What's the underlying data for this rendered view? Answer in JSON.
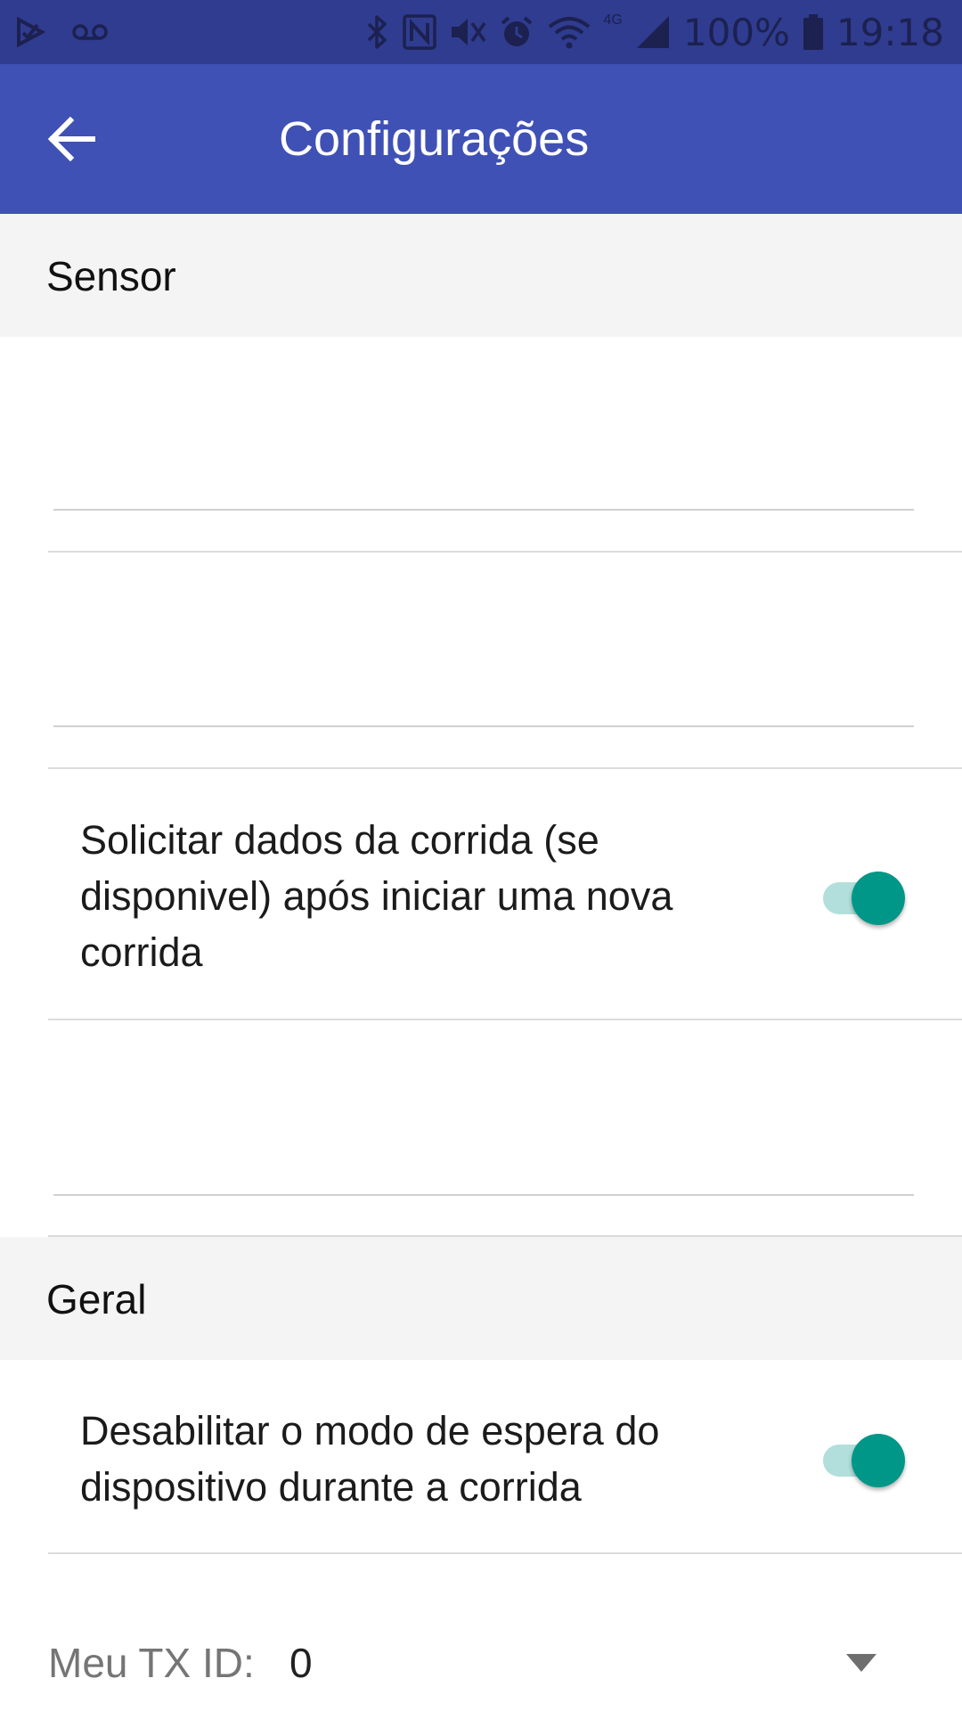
{
  "status_bar": {
    "left_icons": [
      "play-check-icon",
      "voicemail-icon"
    ],
    "right_icons": [
      "bluetooth-icon",
      "nfc-icon",
      "mute-icon",
      "alarm-icon",
      "wifi-icon",
      "signal-icon",
      "battery-icon"
    ],
    "network_label": "4G",
    "battery_text": "100%",
    "time": "19:18"
  },
  "app_bar": {
    "title": "Configurações",
    "back_icon": "arrow-back-icon"
  },
  "sections": {
    "sensor": {
      "header": "Sensor",
      "request_run_data": {
        "label": "Solicitar dados da corrida (se disponivel) após iniciar uma nova corrida",
        "enabled": true
      }
    },
    "general": {
      "header": "Geral",
      "disable_standby": {
        "label": "Desabilitar o modo de espera do dispositivo durante a corrida",
        "enabled": true
      },
      "tx_id": {
        "label": "Meu TX ID:",
        "value": "0",
        "icon": "dropdown-arrow-icon"
      }
    }
  },
  "colors": {
    "status_bar": "#2f3c8f",
    "app_bar": "#3f51b5",
    "section_bg": "#f4f4f4",
    "switch_thumb": "#009688",
    "switch_track": "#b2dfdb"
  }
}
